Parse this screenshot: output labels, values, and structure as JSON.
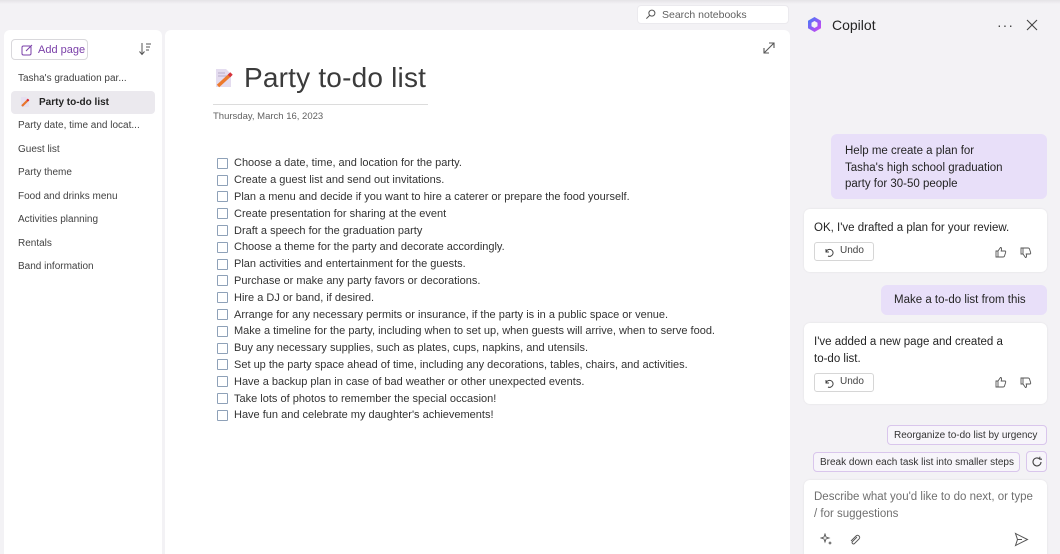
{
  "search": {
    "placeholder": "Search notebooks"
  },
  "sidebar": {
    "add_page_label": "Add page",
    "pages": [
      {
        "label": "Tasha's graduation par...",
        "active": false
      },
      {
        "label": "Party to-do list",
        "active": true
      },
      {
        "label": "Party date, time and locat...",
        "active": false
      },
      {
        "label": "Guest list",
        "active": false
      },
      {
        "label": "Party theme",
        "active": false
      },
      {
        "label": "Food and drinks menu",
        "active": false
      },
      {
        "label": "Activities planning",
        "active": false
      },
      {
        "label": "Rentals",
        "active": false
      },
      {
        "label": "Band information",
        "active": false
      }
    ]
  },
  "page": {
    "title": "Party to-do list",
    "date": "Thursday, March 16, 2023",
    "todos": [
      {
        "text": "Choose a date, time, and location for the party.",
        "checked": false
      },
      {
        "text": "Create a guest list and send out invitations.",
        "checked": false
      },
      {
        "text": "Plan a menu and decide if you want to hire a caterer or prepare the food yourself.",
        "checked": false
      },
      {
        "text": "Create presentation for sharing at the event",
        "checked": false
      },
      {
        "text": "Draft a speech for the graduation party",
        "checked": false
      },
      {
        "text": "Choose a theme for the party and decorate accordingly.",
        "checked": false
      },
      {
        "text": "Plan activities and entertainment for the guests.",
        "checked": false
      },
      {
        "text": "Purchase or make any party favors or decorations.",
        "checked": false
      },
      {
        "text": "Hire a DJ or band, if desired.",
        "checked": false
      },
      {
        "text": "Arrange for any necessary permits or insurance, if the party is in a public space or venue.",
        "checked": false
      },
      {
        "text": "Make a timeline for the party, including when to set up, when guests will arrive, when to serve food.",
        "checked": false
      },
      {
        "text": "Buy any necessary supplies, such as plates, cups, napkins, and utensils.",
        "checked": false
      },
      {
        "text": "Set up the party space ahead of time, including any decorations, tables, chairs, and activities.",
        "checked": false
      },
      {
        "text": "Have a backup plan in case of bad weather or other unexpected events.",
        "checked": false
      },
      {
        "text": "Take lots of photos to remember the special occasion!",
        "checked": false
      },
      {
        "text": "Have fun and celebrate my daughter's achievements!",
        "checked": false
      }
    ]
  },
  "copilot": {
    "title": "Copilot",
    "more_label": "···",
    "messages": {
      "user1_lines": [
        "Help me create a plan for",
        "Tasha's high school graduation",
        "party for 30-50 people"
      ],
      "ai1": "OK, I've drafted a plan for your review.",
      "user2": "Make a to-do list from this",
      "ai2_lines": [
        "I've added a new page and created a",
        "to-do list."
      ],
      "undo_label": "Undo"
    },
    "suggestions": [
      "Reorganize to-do list by urgency",
      "Break down each task list into smaller steps"
    ],
    "composer_placeholder": "Describe what you'd like to do next, or type / for suggestions"
  },
  "colors": {
    "accent": "#7a3fa8",
    "user_bubble": "#e8dff9",
    "background": "#f3f2f5"
  }
}
